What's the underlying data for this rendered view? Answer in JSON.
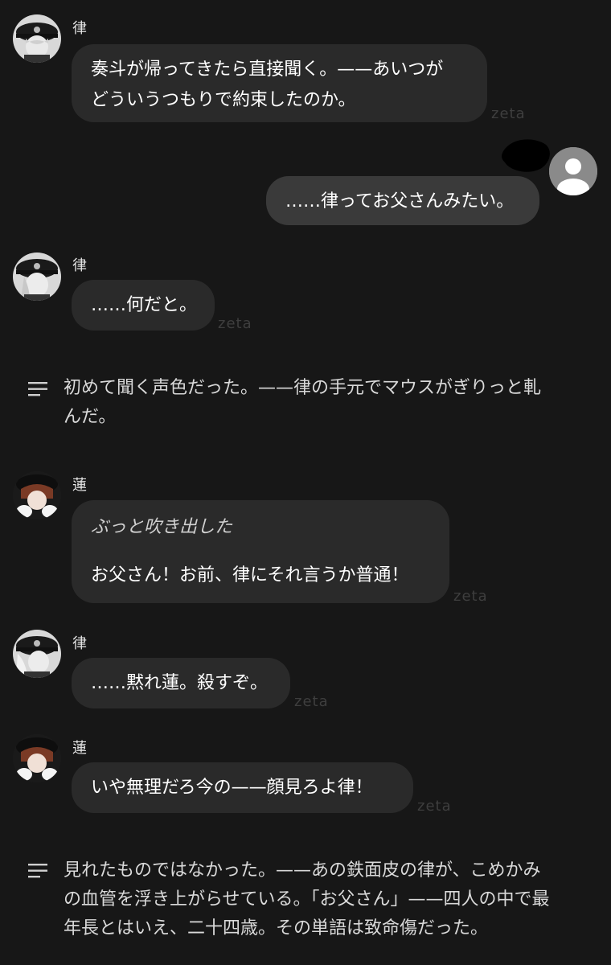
{
  "brand": "zeta",
  "colors": {
    "background": "#171717",
    "bubble": "#2a2a2a",
    "user_bubble": "#3a3a3a",
    "watermark": "#3e3e3e"
  },
  "messages": [
    {
      "speaker": "律",
      "avatar": "ritsu-avatar",
      "text": [
        "奏斗が帰ってきたら直接聞く。——あいつが",
        "どういうつもりで約束したのか。"
      ],
      "watermark": "zeta"
    },
    {
      "speaker": "user",
      "text": [
        "……律ってお父さんみたい。"
      ]
    },
    {
      "speaker": "律",
      "avatar": "ritsu-avatar",
      "text": [
        "……何だと。"
      ],
      "watermark": "zeta"
    },
    {
      "narration": [
        "初めて聞く声色だった。——律の手元でマウスがぎりっと軋",
        "んだ。"
      ]
    },
    {
      "speaker": "蓮",
      "avatar": "ren-avatar",
      "action": "ぶっと吹き出した",
      "text": [
        "お父さん！お前、律にそれ言うか普通！"
      ],
      "watermark": "zeta"
    },
    {
      "speaker": "律",
      "avatar": "ritsu-avatar",
      "text": [
        "……黙れ蓮。殺すぞ。"
      ],
      "watermark": "zeta"
    },
    {
      "speaker": "蓮",
      "avatar": "ren-avatar",
      "text": [
        "いや無理だろ今の——顔見ろよ律！"
      ],
      "watermark": "zeta"
    },
    {
      "narration": [
        "見れたものではなかった。——あの鉄面皮の律が、こめかみ",
        "の血管を浮き上がらせている。「お父さん」——四人の中で最",
        "年長とはいえ、二十四歳。その単語は致命傷だった。"
      ]
    }
  ]
}
